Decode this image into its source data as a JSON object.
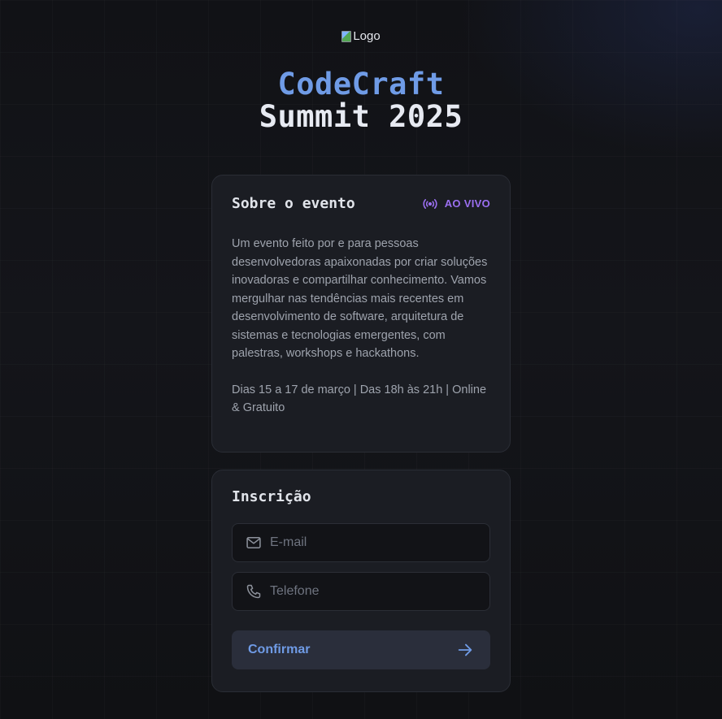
{
  "header": {
    "logo_alt": "Logo",
    "title_line1": "CodeCraft",
    "title_line2": "Summit 2025"
  },
  "about": {
    "title": "Sobre o evento",
    "live_label": "AO VIVO",
    "description": "Um evento feito por e para pessoas desenvolvedoras apaixonadas por criar soluções inovadoras e compartilhar conhecimento. Vamos mergulhar nas tendências mais recentes em desenvolvimento de software, arquitetura de sistemas e tecnologias emergentes, com palestras, workshops e hackathons.",
    "dates": "Dias 15 a 17 de março | Das 18h às 21h | Online & Gratuito"
  },
  "signup": {
    "title": "Inscrição",
    "email_placeholder": "E-mail",
    "phone_placeholder": "Telefone",
    "confirm_label": "Confirmar"
  },
  "icons": {
    "live": "broadcast-icon",
    "email": "mail-icon",
    "phone": "phone-icon",
    "confirm": "arrow-right-icon"
  },
  "colors": {
    "accent_blue": "#6f9be6",
    "live_purple": "#9b6ff0",
    "card_bg": "#1b1d23",
    "page_bg": "#121317"
  }
}
